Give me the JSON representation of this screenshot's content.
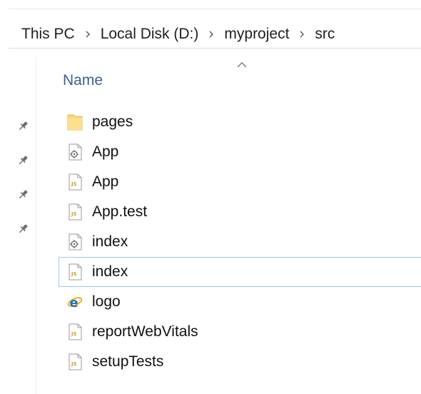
{
  "breadcrumb": {
    "items": [
      "This PC",
      "Local Disk (D:)",
      "myproject",
      "src"
    ]
  },
  "column_header": {
    "label": "Name",
    "sort": "ascending"
  },
  "quick_access_pins": [
    "pin-icon",
    "pin-icon",
    "pin-icon",
    "pin-icon"
  ],
  "files": [
    {
      "name": "pages",
      "icon": "folder-icon",
      "focused": false
    },
    {
      "name": "App",
      "icon": "css-file-icon",
      "focused": false
    },
    {
      "name": "App",
      "icon": "js-file-icon",
      "focused": false
    },
    {
      "name": "App.test",
      "icon": "js-file-icon",
      "focused": false
    },
    {
      "name": "index",
      "icon": "css-file-icon",
      "focused": false
    },
    {
      "name": "index",
      "icon": "js-file-icon",
      "focused": true
    },
    {
      "name": "logo",
      "icon": "ie-file-icon",
      "focused": false
    },
    {
      "name": "reportWebVitals",
      "icon": "js-file-icon",
      "focused": false
    },
    {
      "name": "setupTests",
      "icon": "js-file-icon",
      "focused": false
    }
  ],
  "colors": {
    "header_text": "#3c5f8c",
    "focus_border": "#99c9ef",
    "folder_yellow": "#f8d775",
    "ie_blue": "#1f6fc5",
    "js_label": "#c9a227"
  }
}
